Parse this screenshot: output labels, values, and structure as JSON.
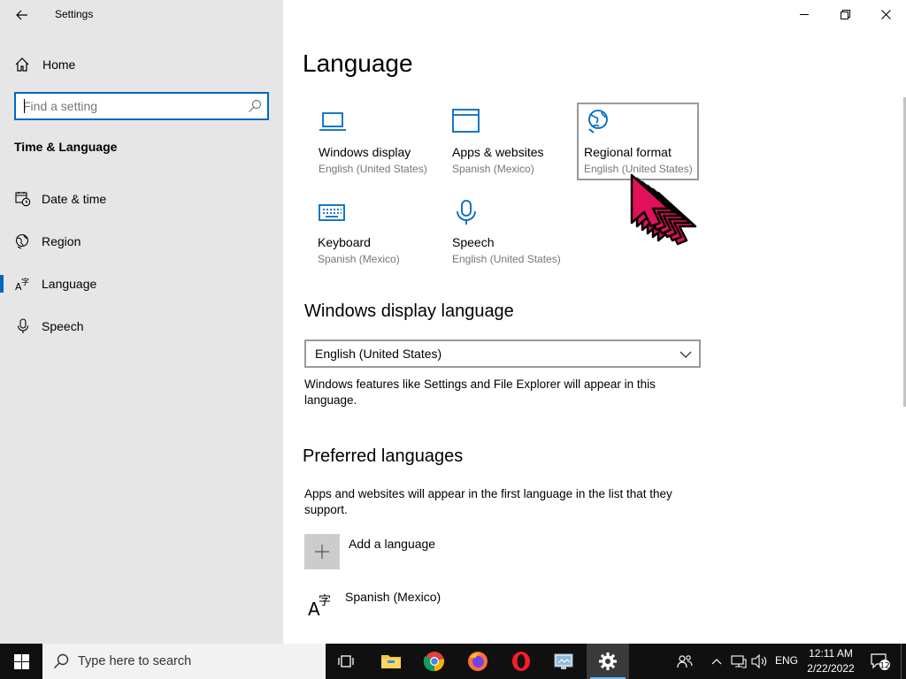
{
  "window": {
    "app_title": "Settings",
    "controls": {
      "minimize": "minimize-icon",
      "maximize": "restore-icon",
      "close": "close-icon"
    }
  },
  "sidebar": {
    "home_label": "Home",
    "search_placeholder": "Find a setting",
    "section_title": "Time & Language",
    "items": [
      {
        "label": "Date & time",
        "icon": "calendar-clock-icon",
        "selected": false
      },
      {
        "label": "Region",
        "icon": "globe-region-icon",
        "selected": false
      },
      {
        "label": "Language",
        "icon": "language-icon",
        "selected": true
      },
      {
        "label": "Speech",
        "icon": "microphone-icon",
        "selected": false
      }
    ]
  },
  "main": {
    "title": "Language",
    "tiles": [
      {
        "label": "Windows display",
        "sub": "English (United States)",
        "icon": "laptop-icon"
      },
      {
        "label": "Apps & websites",
        "sub": "Spanish (Mexico)",
        "icon": "browser-window-icon"
      },
      {
        "label": "Regional format",
        "sub": "English (United States)",
        "icon": "globe-icon"
      },
      {
        "label": "Keyboard",
        "sub": "Spanish (Mexico)",
        "icon": "keyboard-icon"
      },
      {
        "label": "Speech",
        "sub": "English (United States)",
        "icon": "microphone-icon"
      }
    ],
    "display_language": {
      "heading": "Windows display language",
      "selected": "English (United States)",
      "description": "Windows features like Settings and File Explorer will appear in this language."
    },
    "preferred": {
      "heading": "Preferred languages",
      "description": "Apps and websites will appear in the first language in the list that they support.",
      "add_label": "Add a language",
      "languages": [
        "Spanish (Mexico)"
      ]
    }
  },
  "taskbar": {
    "search_text": "Type here to search",
    "apps": [
      "task-view-icon",
      "file-explorer-icon",
      "chrome-icon",
      "firefox-icon",
      "opera-icon",
      "control-panel-icon",
      "settings-gear-icon"
    ],
    "active_app": "settings-gear-icon",
    "language_indicator": "ENG",
    "time": "12:11 AM",
    "date": "2/22/2022",
    "notification_count": "12"
  },
  "colors": {
    "accent": "#0067c0",
    "sidebar_bg": "#e6e6e6",
    "taskbar_bg": "#101010",
    "cursor": "#e0105a"
  }
}
